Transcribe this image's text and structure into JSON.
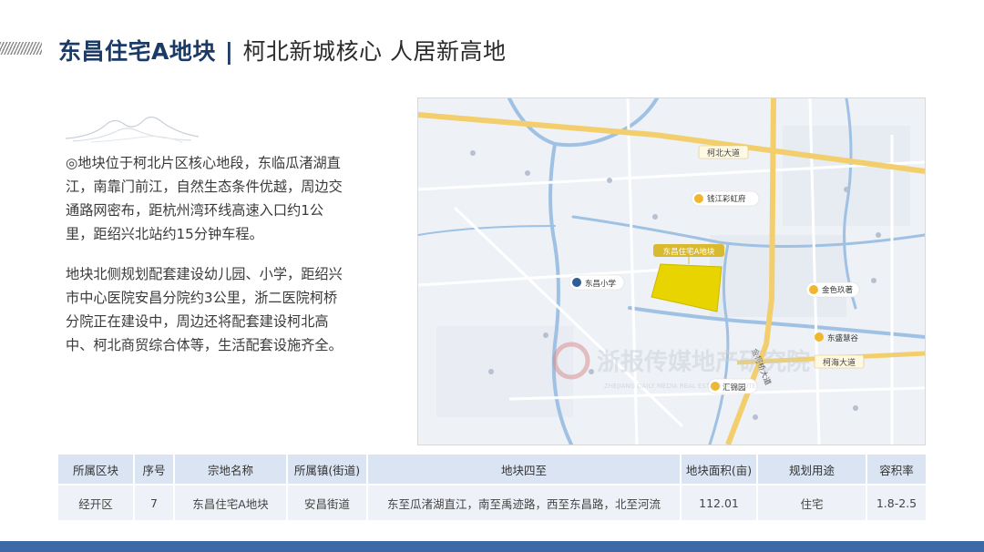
{
  "header": {
    "title_main": "东昌住宅A地块",
    "separator": "|",
    "title_sub": "柯北新城核心  人居新高地"
  },
  "paragraphs": [
    "◎地块位于柯北片区核心地段，东临瓜渚湖直江，南靠门前江，自然生态条件优越，周边交通路网密布，距杭州湾环线高速入口约1公里，距绍兴北站约15分钟车程。",
    "地块北侧规划配套建设幼儿园、小学，距绍兴市中心医院安昌分院约3公里，浙二医院柯桥分院正在建设中，周边还将配套建设柯北高中、柯北商贸综合体等，生活配套设施齐全。"
  ],
  "map": {
    "labels": {
      "road_kebei": "柯北大道",
      "road_kehai": "柯海大道",
      "road_jinke": "金柯桥大道",
      "poi_qianjiang": "钱江彩虹府",
      "poi_site": "东昌住宅A地块",
      "poi_school": "东昌小学",
      "poi_jinyu": "金色玖著",
      "poi_dongsheng": "东盛慧谷",
      "poi_huijin": "汇锦园"
    },
    "watermark": "浙报传媒地产研究院",
    "watermark_en": "ZHEJIANG DAILY MEDIA REAL ESTATE INSTITUTE"
  },
  "table": {
    "headers": [
      "所属区块",
      "序号",
      "宗地名称",
      "所属镇(街道)",
      "地块四至",
      "地块面积(亩)",
      "规划用途",
      "容积率"
    ],
    "rows": [
      [
        "经开区",
        "7",
        "东昌住宅A地块",
        "安昌街道",
        "东至瓜渚湖直江，南至禹迹路，西至东昌路，北至河流",
        "112.01",
        "住宅",
        "1.8-2.5"
      ]
    ]
  },
  "colors": {
    "title_blue": "#1c3a66",
    "accent_bar": "#3d6aa6",
    "road_yellow": "#f2cf6c",
    "site_yellow": "#e8d400",
    "water_blue": "#9fc1e3"
  }
}
